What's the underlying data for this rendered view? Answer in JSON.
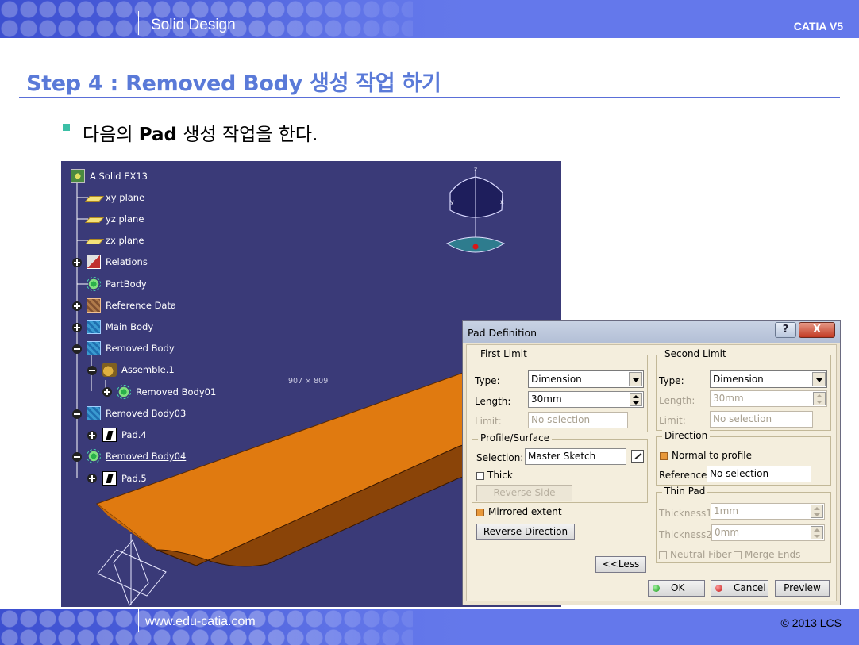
{
  "header": {
    "title": "Solid Design",
    "brand": "CATIA V5"
  },
  "slide": {
    "title": "Step 4 : Removed Body 생성 작업 하기",
    "bullet_pre": "다음의 ",
    "bullet_bold": "Pad",
    "bullet_post": " 생성 작업을 한다."
  },
  "viewport": {
    "background_color": "#3a3a78",
    "part_color": "#e07a10",
    "coord_readout": "907 ⨯ 809",
    "compass": {
      "z": "z",
      "x": "x",
      "y": "y"
    },
    "tree": [
      {
        "label": "A Solid EX13",
        "icon": "part-icon"
      },
      {
        "label": "xy plane",
        "icon": "plane-icon"
      },
      {
        "label": "yz plane",
        "icon": "plane-icon"
      },
      {
        "label": "zx plane",
        "icon": "plane-icon"
      },
      {
        "label": "Relations",
        "icon": "relations-icon"
      },
      {
        "label": "PartBody",
        "icon": "partbody-icon"
      },
      {
        "label": "Reference Data",
        "icon": "body-icon"
      },
      {
        "label": "Main Body",
        "icon": "body-icon"
      },
      {
        "label": "Removed Body",
        "icon": "body-icon"
      },
      {
        "label": "Assemble.1",
        "icon": "assemble-icon"
      },
      {
        "label": "Removed Body01",
        "icon": "body-icon"
      },
      {
        "label": "Removed Body03",
        "icon": "body-icon"
      },
      {
        "label": "Pad.4",
        "icon": "pad-icon"
      },
      {
        "label": "Removed Body04",
        "icon": "body-icon"
      },
      {
        "label": "Pad.5",
        "icon": "pad-icon"
      }
    ]
  },
  "dialog": {
    "title": "Pad Definition",
    "help": "?",
    "close": "X",
    "first_limit": {
      "legend": "First Limit",
      "type_label": "Type:",
      "type_value": "Dimension",
      "length_label": "Length:",
      "length_value": "30mm",
      "limit_label": "Limit:",
      "limit_value": "No selection"
    },
    "second_limit": {
      "legend": "Second Limit",
      "type_label": "Type:",
      "type_value": "Dimension",
      "length_label": "Length:",
      "length_value": "30mm",
      "limit_label": "Limit:",
      "limit_value": "No selection"
    },
    "profile": {
      "legend": "Profile/Surface",
      "selection_label": "Selection:",
      "selection_value": "Master Sketch",
      "thick_label": "Thick",
      "reverse_side": "Reverse Side"
    },
    "direction": {
      "legend": "Direction",
      "normal_label": "Normal to profile",
      "reference_label": "Reference:",
      "reference_value": "No selection"
    },
    "thin_pad": {
      "legend": "Thin Pad",
      "thickness1_label": "Thickness1:",
      "thickness1_value": "1mm",
      "thickness2_label": "Thickness2:",
      "thickness2_value": "0mm",
      "neutral_fiber": "Neutral Fiber",
      "merge_ends": "Merge Ends"
    },
    "mirrored_extent": "Mirrored extent",
    "reverse_direction": "Reverse Direction",
    "less": "<<Less",
    "ok": "OK",
    "cancel": "Cancel",
    "preview": "Preview"
  },
  "footer": {
    "url": "www.edu-catia.com",
    "copyright": "© 2013 LCS"
  }
}
